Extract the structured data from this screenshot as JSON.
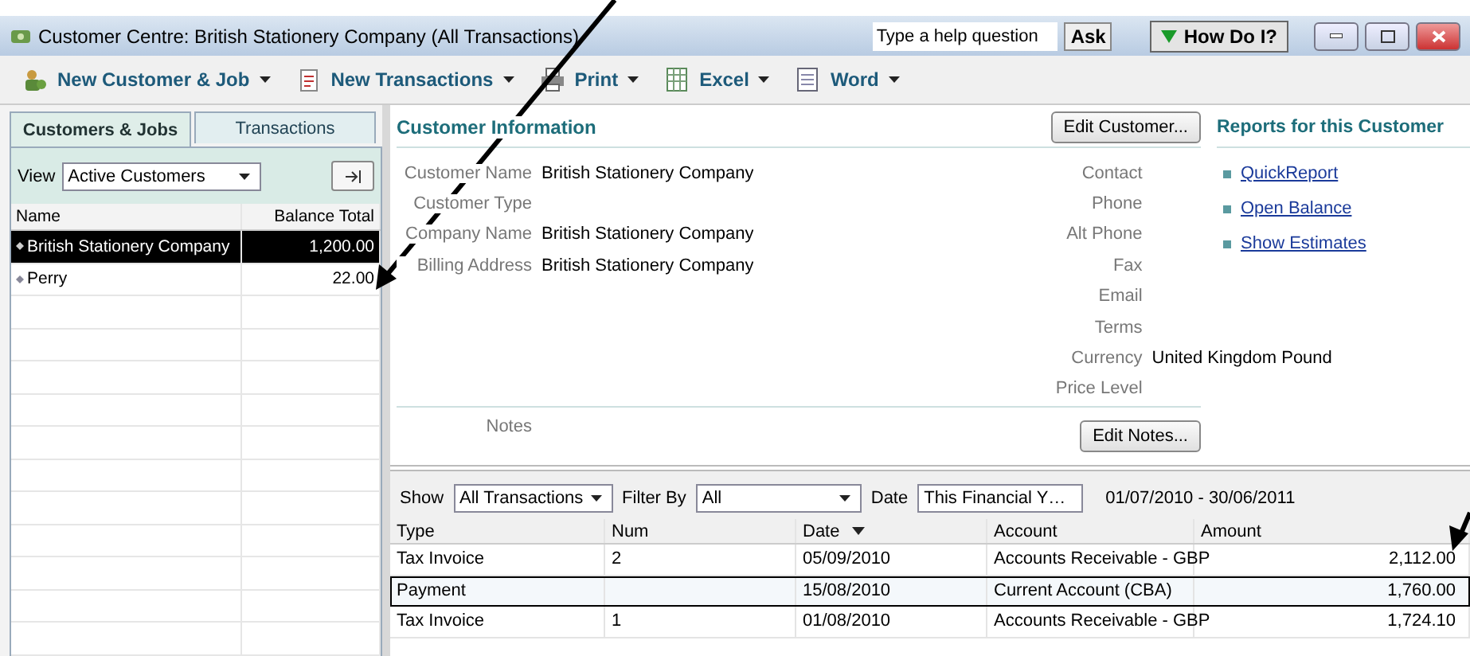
{
  "window": {
    "title": "Customer Centre: British Stationery Company (All Transactions)",
    "help_placeholder": "Type a help question",
    "ask_button": "Ask",
    "how_do_i_button": "How Do I?"
  },
  "toolbar": [
    {
      "label": "New Customer & Job"
    },
    {
      "label": "New Transactions"
    },
    {
      "label": "Print"
    },
    {
      "label": "Excel"
    },
    {
      "label": "Word"
    }
  ],
  "tabs": [
    {
      "label": "Customers & Jobs",
      "selected": true
    },
    {
      "label": "Transactions",
      "selected": false
    }
  ],
  "view": {
    "label": "View",
    "value": "Active Customers"
  },
  "customer_list": {
    "columns": [
      "Name",
      "Balance Total"
    ],
    "rows": [
      {
        "name": "British Stationery Company",
        "balance": "1,200.00",
        "selected": true
      },
      {
        "name": "Perry",
        "balance": "22.00",
        "selected": false
      }
    ]
  },
  "customer_info": {
    "title": "Customer Information",
    "edit_button": "Edit Customer...",
    "fields_left": [
      {
        "label": "Customer Name",
        "value": "British Stationery Company"
      },
      {
        "label": "Customer Type"
      },
      {
        "label": "Company Name",
        "value": "British Stationery Company"
      },
      {
        "label": "Billing Address",
        "value": "British Stationery Company"
      }
    ],
    "fields_right": [
      {
        "label": "Contact"
      },
      {
        "label": "Phone"
      },
      {
        "label": "Alt Phone"
      },
      {
        "label": "Fax"
      },
      {
        "label": "Email"
      },
      {
        "label": "Terms"
      },
      {
        "label": "Currency",
        "value": "United Kingdom Pound"
      },
      {
        "label": "Price Level"
      }
    ],
    "notes_label": "Notes",
    "edit_notes_button": "Edit Notes..."
  },
  "reports": {
    "title": "Reports for this Customer",
    "links": [
      "QuickReport",
      "Open Balance",
      "Show Estimates"
    ]
  },
  "filters": [
    {
      "label": "Show",
      "value": "All Transactions"
    },
    {
      "label": "Filter By",
      "value": "All"
    },
    {
      "label": "Date",
      "value": "This Financial Y…"
    }
  ],
  "date_range": "01/07/2010 - 30/06/2011",
  "transactions": {
    "columns": [
      {
        "label": "Type",
        "sorted": false
      },
      {
        "label": "Num",
        "sorted": false
      },
      {
        "label": "Date",
        "sorted": true
      },
      {
        "label": "Account",
        "sorted": false
      },
      {
        "label": "Amount",
        "sorted": false
      }
    ],
    "rows": [
      {
        "cells": [
          "Tax Invoice",
          "2",
          "05/09/2010",
          "Accounts Receivable - GBP",
          "2,112.00"
        ],
        "selected": false
      },
      {
        "cells": [
          "Payment",
          "",
          "15/08/2010",
          "Current Account (CBA)",
          "1,760.00"
        ],
        "selected": true
      },
      {
        "cells": [
          "Tax Invoice",
          "1",
          "01/08/2010",
          "Accounts Receivable - GBP",
          "1,724.10"
        ],
        "selected": false
      }
    ]
  }
}
